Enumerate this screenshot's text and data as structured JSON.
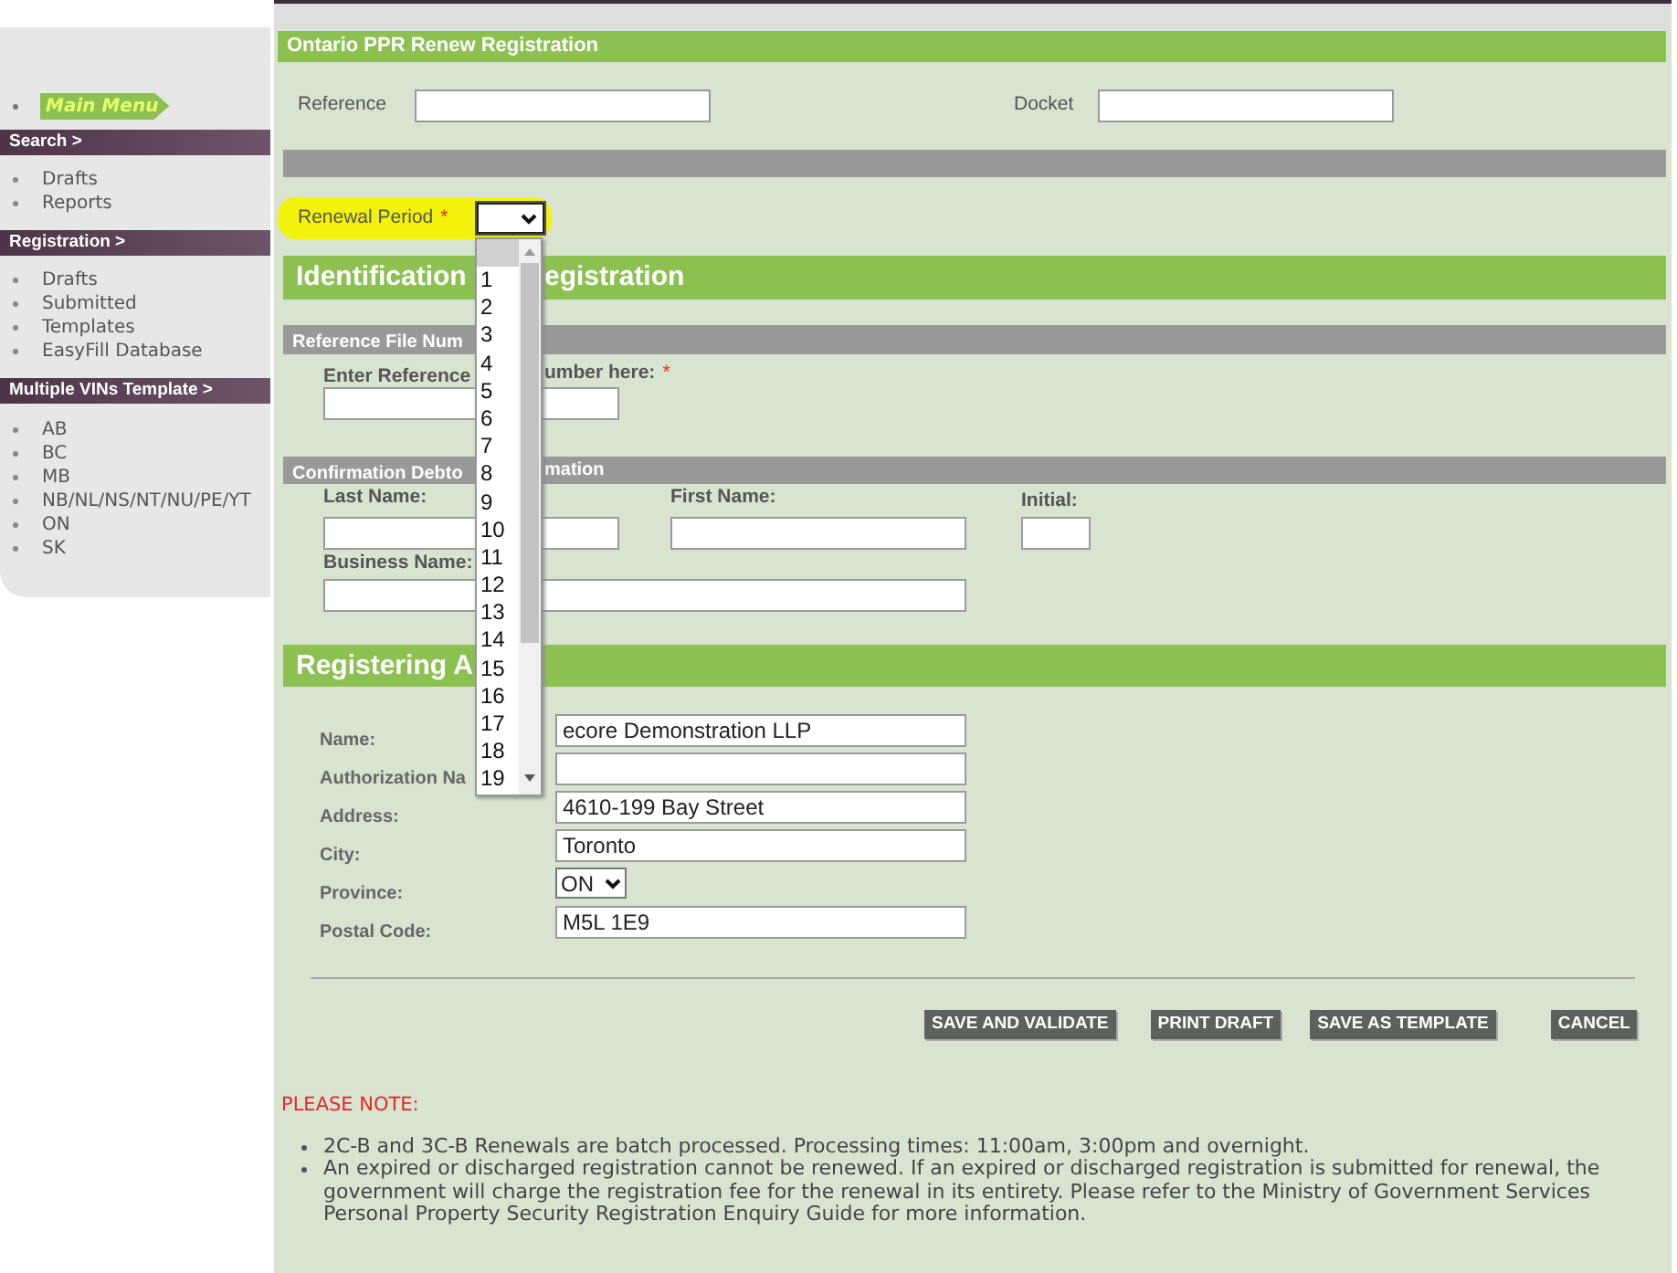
{
  "sidebar": {
    "main_menu": "Main Menu",
    "sections": [
      {
        "title": "Search >",
        "items": [
          "Drafts",
          "Reports"
        ]
      },
      {
        "title": "Registration >",
        "items": [
          "Drafts",
          "Submitted",
          "Templates",
          "EasyFill Database"
        ]
      },
      {
        "title": "Multiple VINs Template >",
        "items": [
          "AB",
          "BC",
          "MB",
          "NB/NL/NS/NT/NU/PE/YT",
          "ON",
          "SK"
        ]
      }
    ]
  },
  "form": {
    "title": "Ontario PPR Renew Registration",
    "reference": {
      "label": "Reference"
    },
    "docket": {
      "label": "Docket"
    },
    "renewal_period": {
      "label": "Renewal Period",
      "required_mark": "*",
      "highlighted": true,
      "expanded": true,
      "blank_option_highlighted": true,
      "options": [
        "1",
        "2",
        "3",
        "4",
        "5",
        "6",
        "7",
        "8",
        "9",
        "10",
        "11",
        "12",
        "13",
        "14",
        "15",
        "16",
        "17",
        "18",
        "19"
      ]
    },
    "identification": {
      "heading_parts": [
        "Identification",
        "egistration"
      ]
    },
    "reference_file": {
      "bar_parts": [
        "Reference File Num"
      ],
      "prompt_parts": [
        "Enter Reference",
        "umber here:"
      ],
      "required_mark": "*"
    },
    "debtor": {
      "bar_parts": [
        "Confirmation Debto",
        "mation"
      ],
      "last_name": "Last Name:",
      "first_name": "First Name:",
      "initial": "Initial:",
      "business_name": "Business Name:"
    },
    "registering_agent": {
      "heading_parts": [
        "Registering A"
      ],
      "fields": [
        {
          "kind": "text",
          "label": "Name:",
          "value": "ecore Demonstration LLP"
        },
        {
          "kind": "text",
          "label": "Authorization Na"
        },
        {
          "kind": "text",
          "label": "Address:",
          "value": "4610-199 Bay Street"
        },
        {
          "kind": "text",
          "label": "City:",
          "value": "Toronto"
        },
        {
          "kind": "select",
          "label": "Province:",
          "value": "ON"
        },
        {
          "kind": "text",
          "label": "Postal Code:",
          "value": "M5L 1E9"
        }
      ]
    }
  },
  "buttons": [
    "SAVE AND VALIDATE",
    "PRINT DRAFT",
    "SAVE AS TEMPLATE",
    "CANCEL"
  ],
  "note": {
    "title": "PLEASE NOTE:",
    "items": [
      "2C-B and 3C-B Renewals are batch processed. Processing times: 11:00am, 3:00pm and overnight.",
      "An expired or discharged registration cannot be renewed. If an expired or discharged registration is submitted for renewal, the government will charge the registration fee for the renewal in its entirety. Please refer to the Ministry of Government Services Personal Property Security Registration Enquiry Guide for more information."
    ]
  }
}
